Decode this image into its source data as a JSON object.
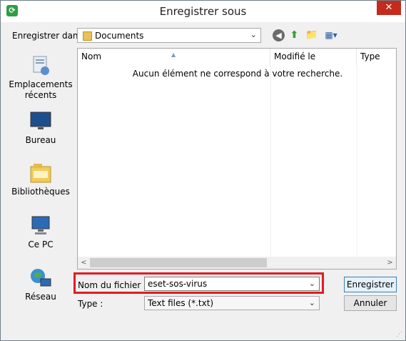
{
  "window": {
    "title": "Enregistrer sous"
  },
  "toolbar": {
    "save_in_label": "Enregistrer dans :",
    "location": "Documents"
  },
  "places": [
    {
      "label": "Emplacements récents",
      "icon": "recent-places-icon"
    },
    {
      "label": "Bureau",
      "icon": "desktop-icon"
    },
    {
      "label": "Bibliothèques",
      "icon": "libraries-icon"
    },
    {
      "label": "Ce PC",
      "icon": "computer-icon"
    },
    {
      "label": "Réseau",
      "icon": "network-icon"
    }
  ],
  "filelist": {
    "columns": [
      "Nom",
      "Modifié le",
      "Type"
    ],
    "empty_message": "Aucun élément ne correspond à votre recherche."
  },
  "form": {
    "filename_label": "Nom du fichier :",
    "filename_value": "eset-sos-virus",
    "type_label": "Type :",
    "type_value": "Text files (*.txt)"
  },
  "buttons": {
    "save": "Enregistrer",
    "cancel": "Annuler"
  },
  "colors": {
    "highlight": "#e31b23",
    "close": "#c42b1c",
    "primary_border": "#3c7fb1"
  }
}
